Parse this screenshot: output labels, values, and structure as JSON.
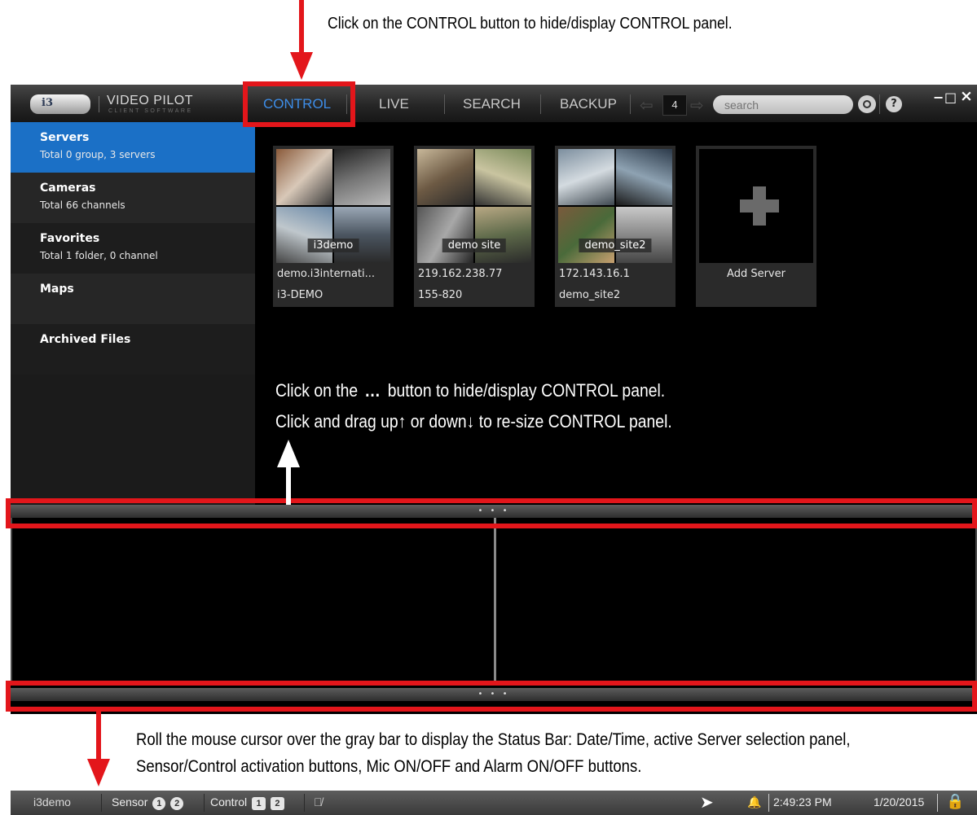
{
  "annotations": {
    "top": "Click on the CONTROL button to hide/display CONTROL panel.",
    "mid_line1_pre": "Click on the",
    "mid_line1_dots": "...",
    "mid_line1_post": "button to hide/display CONTROL panel.",
    "mid_line2_pre": "Click and drag up",
    "mid_line2_up": "↑",
    "mid_line2_mid": "or down",
    "mid_line2_down": "↓",
    "mid_line2_post": "to re-size CONTROL panel.",
    "bottom_line1": "Roll the mouse cursor over the gray bar to display the Status Bar: Date/Time, active Server selection panel,",
    "bottom_line2": "Sensor/Control activation buttons, Mic ON/OFF and Alarm ON/OFF buttons."
  },
  "app": {
    "logo_text": "i3",
    "title": "VIDEO PILOT",
    "subtitle": "CLIENT SOFTWARE",
    "tabs": [
      "CONTROL",
      "LIVE",
      "SEARCH",
      "BACKUP"
    ],
    "active_tab": "CONTROL",
    "page_number": "4",
    "search_placeholder": "search",
    "help_label": "?",
    "minimize": "−",
    "maximize": "□",
    "close": "×"
  },
  "sidebar": {
    "items": [
      {
        "title": "Servers",
        "subtitle": "Total 0 group, 3 servers"
      },
      {
        "title": "Cameras",
        "subtitle": "Total 66 channels"
      },
      {
        "title": "Favorites",
        "subtitle": "Total 1 folder, 0 channel"
      },
      {
        "title": "Maps",
        "subtitle": ""
      },
      {
        "title": "Archived Files",
        "subtitle": ""
      }
    ]
  },
  "servers": [
    {
      "thumb_label": "i3demo",
      "address": "demo.i3internati...",
      "name": "i3-DEMO"
    },
    {
      "thumb_label": "demo site",
      "address": "219.162.238.77",
      "name": "155-820"
    },
    {
      "thumb_label": "demo_site2",
      "address": "172.143.16.1",
      "name": "demo_site2"
    }
  ],
  "add_server_label": "Add Server",
  "splitter_dots": "• • •",
  "statusbar": {
    "server": "i3demo",
    "sensor_label": "Sensor",
    "sensor_buttons": [
      "1",
      "2"
    ],
    "control_label": "Control",
    "control_buttons": [
      "1",
      "2"
    ],
    "time": "2:49:23 PM",
    "date": "1/20/2015"
  },
  "colors": {
    "accent_red": "#e3161b",
    "active_blue": "#1b70c6",
    "tab_active": "#3d8de8"
  }
}
